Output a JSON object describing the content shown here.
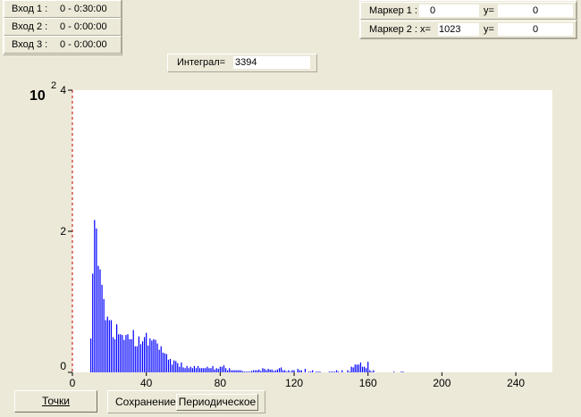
{
  "inputs": [
    {
      "label": "Вход 1 :",
      "value": "0 - 0:30:00"
    },
    {
      "label": "Вход 2 :",
      "value": "0 - 0:00:00"
    },
    {
      "label": "Вход 3 :",
      "value": "0 - 0:00:00"
    }
  ],
  "markers": [
    {
      "label": "Маркер 1 : x=",
      "x": "0",
      "y_label": "y=",
      "y": "0"
    },
    {
      "label": "Маркер 2 : x=",
      "x": "1023",
      "y_label": "y=",
      "y": "0"
    }
  ],
  "integral": {
    "label": "Интеграл=",
    "value": "3394"
  },
  "buttons": {
    "points": "Точки",
    "save_label": "Сохранение",
    "save_mode": "Периодическое"
  },
  "chart_data": {
    "type": "bar",
    "y_scale_label": "10",
    "y_scale_exp": "2",
    "xlim": [
      0,
      260
    ],
    "ylim": [
      0,
      400
    ],
    "x_ticks": [
      "0",
      "40",
      "80",
      "120",
      "160",
      "200",
      "240"
    ],
    "y_ticks": [
      "0",
      "2",
      "4"
    ],
    "bar_color": "#0000ff",
    "axis_color": "#cc0000",
    "x": [
      10,
      11,
      12,
      13,
      14,
      15,
      16,
      17,
      18,
      19,
      20,
      21,
      22,
      23,
      24,
      25,
      26,
      27,
      28,
      29,
      30,
      31,
      32,
      33,
      34,
      35,
      36,
      37,
      38,
      39,
      40,
      41,
      42,
      43,
      44,
      45,
      46,
      47,
      48,
      49,
      50,
      51,
      52,
      53,
      54,
      55,
      56,
      57,
      58,
      59,
      60,
      61,
      62,
      63,
      64,
      65,
      66,
      67,
      68,
      69,
      70,
      71,
      72,
      73,
      74,
      75,
      76,
      77,
      78,
      79,
      80,
      81,
      82,
      83,
      84,
      85,
      86,
      87,
      88,
      89,
      90,
      91,
      92,
      93,
      94,
      95,
      96,
      97,
      98,
      99,
      100,
      101,
      102,
      103,
      104,
      105,
      106,
      107,
      108,
      109,
      110,
      111,
      112,
      113,
      114,
      115,
      116,
      117,
      118,
      119,
      120,
      122,
      123,
      124,
      126,
      128,
      129,
      130,
      132,
      133,
      134,
      139,
      140,
      141,
      142,
      143,
      144,
      146,
      149,
      150,
      151,
      152,
      153,
      154,
      155,
      156,
      157,
      158,
      159,
      160,
      161,
      162,
      163,
      174,
      178,
      179
    ],
    "values": [
      48,
      140,
      216,
      204,
      151,
      146,
      124,
      104,
      74,
      79,
      74,
      74,
      50,
      47,
      68,
      54,
      54,
      53,
      46,
      53,
      54,
      47,
      47,
      60,
      37,
      37,
      51,
      40,
      44,
      50,
      56,
      38,
      48,
      45,
      47,
      46,
      41,
      32,
      37,
      28,
      27,
      26,
      18,
      19,
      11,
      17,
      16,
      13,
      8,
      14,
      7,
      6,
      9,
      6,
      8,
      6,
      9,
      6,
      9,
      6,
      6,
      6,
      6,
      8,
      6,
      6,
      9,
      4,
      6,
      5,
      8,
      8,
      10,
      6,
      3,
      6,
      3,
      3,
      3,
      3,
      3,
      3,
      2,
      1,
      1,
      1,
      1,
      2,
      3,
      3,
      3,
      4,
      2,
      6,
      5,
      3,
      5,
      4,
      4,
      2,
      3,
      4,
      6,
      7,
      3,
      3,
      1,
      3,
      1,
      3,
      3,
      5,
      3,
      3,
      5,
      1,
      1,
      3,
      1,
      1,
      1,
      1,
      1,
      1,
      1,
      3,
      1,
      3,
      3,
      1,
      8,
      7,
      11,
      11,
      11,
      14,
      8,
      8,
      6,
      15,
      3,
      1,
      3,
      1,
      1,
      1
    ]
  }
}
